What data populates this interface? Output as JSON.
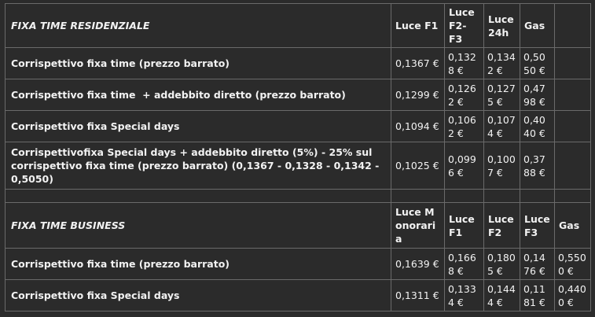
{
  "residenziale": {
    "title": "FIXA TIME RESIDENZIALE",
    "headers": [
      "Luce F1",
      "Luce F2-F3",
      "Luce 24h",
      "Gas"
    ],
    "rows": [
      {
        "label": "Corrispettivo fixa time (prezzo barrato)",
        "values": [
          "0,1367 €",
          "0,1328 €",
          "0,1342 €",
          "0,5050 €"
        ]
      },
      {
        "label": "Corrispettivo fixa time  + addebbito diretto (prezzo barrato)",
        "values": [
          "0,1299 €",
          "0,1262 €",
          "0,1275 €",
          "0,4798 €"
        ]
      },
      {
        "label": "Corrispettivo fixa Special days",
        "values": [
          "0,1094 €",
          "0,1062 €",
          "0,1074 €",
          "0,4040 €"
        ]
      },
      {
        "label": "Corrispettivofixa Special days + addebbito diretto (5%) - 25% sul corrispettivo fixa time (prezzo barrato) (0,1367 - 0,1328 - 0,1342 - 0,5050)",
        "values": [
          "0,1025 €",
          "0,0996 €",
          "0,1007 €",
          "0,3788 €"
        ]
      }
    ]
  },
  "business": {
    "title": "FIXA TIME BUSINESS",
    "headers": [
      "Luce Monoraria",
      "Luce F1",
      "Luce F2",
      "Luce F3",
      "Gas"
    ],
    "rows": [
      {
        "label": "Corrispettivo fixa time (prezzo barrato)",
        "values": [
          "0,1639 €",
          "0,1668 €",
          "0,1805 €",
          "0,1476 €",
          "0,5500 €"
        ]
      },
      {
        "label": "Corrispettivo fixa Special days",
        "values": [
          "0,1311 €",
          "0,1334 €",
          "0,1444 €",
          "0,1181 €",
          "0,4400 €"
        ]
      }
    ]
  }
}
